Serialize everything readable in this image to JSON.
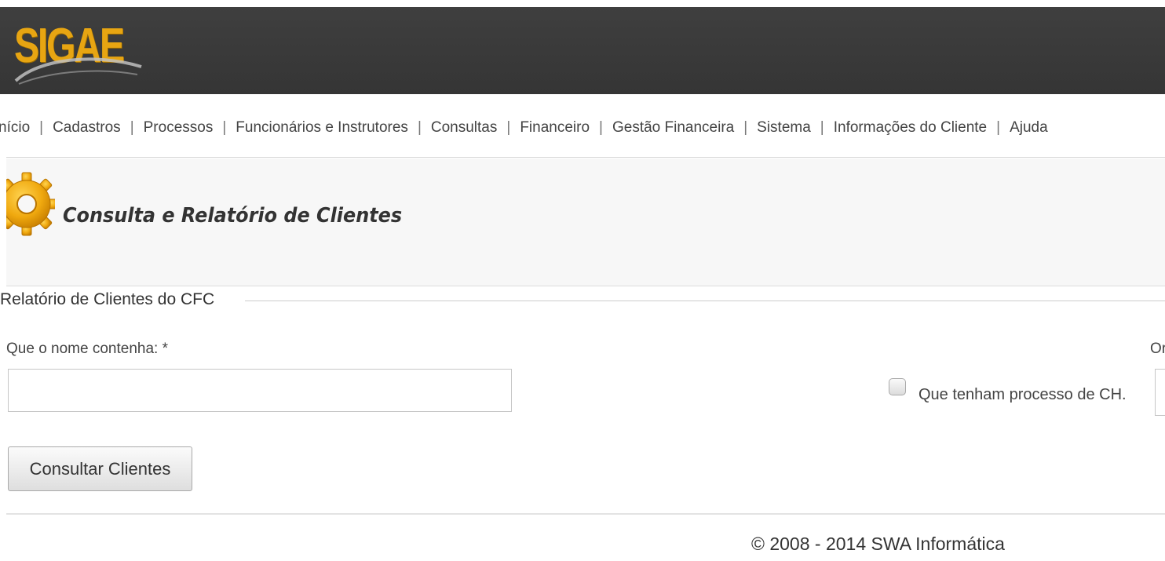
{
  "header": {
    "logo_text": "SIGAE"
  },
  "menu": {
    "items": [
      {
        "label": "nício"
      },
      {
        "label": "Cadastros"
      },
      {
        "label": "Processos"
      },
      {
        "label": "Funcionários e Instrutores"
      },
      {
        "label": "Consultas"
      },
      {
        "label": "Financeiro"
      },
      {
        "label": "Gestão Financeira"
      },
      {
        "label": "Sistema"
      },
      {
        "label": "Informações do Cliente"
      },
      {
        "label": "Ajuda"
      }
    ],
    "separator": "|"
  },
  "page": {
    "title": "Consulta e Relatório de Clientes",
    "icon": "gear-icon"
  },
  "form": {
    "legend": "Relatório de Clientes do CFC",
    "name_label": "Que o nome contenha: *",
    "name_value": "",
    "checkbox_label": "Que tenham processo de CH.",
    "checkbox_checked": false,
    "right_label": "Or",
    "submit_label": "Consultar Clientes"
  },
  "footer": {
    "copyright": "© 2008 - 2014 SWA Informática"
  },
  "colors": {
    "header_bg": "#3a3a3a",
    "logo": "#e7a512",
    "title_box_bg": "#f7f7f7"
  }
}
